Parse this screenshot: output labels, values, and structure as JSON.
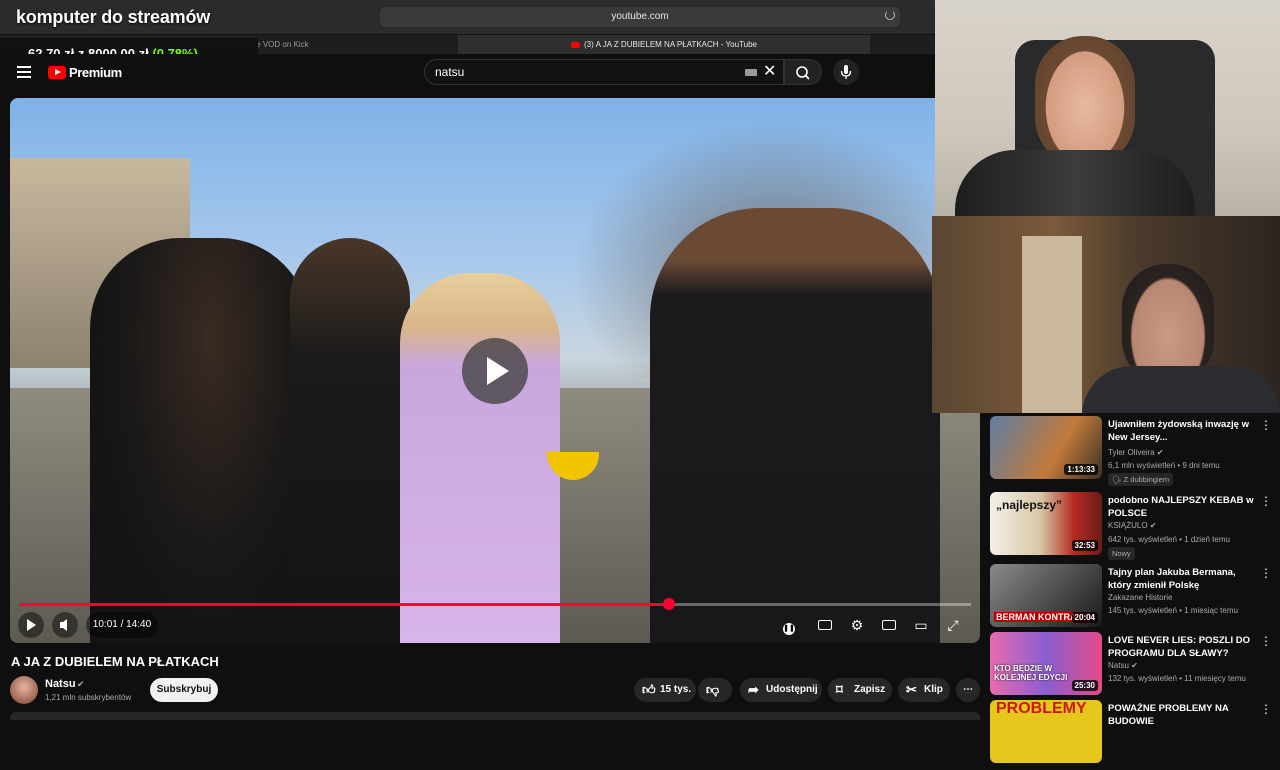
{
  "overlay": {
    "title": "komputer do streamów"
  },
  "browser": {
    "url": "youtube.com",
    "tab_inactive_label": "Watch the VOD on Kick",
    "tab_inactive_prefix": "sikkk",
    "tab_active_label": "(3) A JA Z DUBIELEM NA PŁATKACH - YouTube"
  },
  "price": {
    "amount": "62,70 zł",
    "of": "z",
    "goal": "8000,00 zł",
    "percent": "(0.78%)"
  },
  "header": {
    "logo_text": "Premium",
    "search_value": "natsu"
  },
  "player": {
    "time": "10:01 / 14:40",
    "progress": 0.683
  },
  "video": {
    "title": "A JA Z DUBIELEM NA PŁATKACH",
    "channel": "Natsu",
    "subscribers": "1,21 mln subskrybentów",
    "subscribe_label": "Subskrybuj",
    "likes": "15 tys.",
    "share_label": "Udostępnij",
    "save_label": "Zapisz",
    "clip_label": "Klip"
  },
  "related": [
    {
      "title": "Ujawniłem żydowską inwazję w New Jersey...",
      "channel": "Tyler Oliveira",
      "meta": "6,1 mln wyświetleń • 9 dni temu",
      "badge": "Z dubbingiem",
      "duration": "1:13:33"
    },
    {
      "title": "podobno NAJLEPSZY KEBAB w POLSCE",
      "channel": "KSIĄŻULO",
      "meta": "642 tys. wyświetleń • 1 dzień temu",
      "badge": "Nowy",
      "duration": "32:53",
      "thumb_text": "„najlepszy”"
    },
    {
      "title": "Tajny plan Jakuba Bermana, który zmienił Polskę",
      "channel": "Zakazane Historie",
      "meta": "145 tys. wyświetleń • 1 miesiąc temu",
      "duration": "20:04",
      "thumb_text": "BERMAN KONTRA PO"
    },
    {
      "title": "LOVE NEVER LIES: POSZLI DO PROGRAMU DLA SŁAWY?",
      "channel": "Natsu",
      "meta": "132 tys. wyświetleń • 11 miesięcy temu",
      "duration": "25:30",
      "thumb_text": "KTO BĘDZIE W KOLEJNEJ EDYCJI"
    },
    {
      "title": "POWAŻNE PROBLEMY NA BUDOWIE",
      "thumb_text": "PROBLEMY"
    }
  ]
}
